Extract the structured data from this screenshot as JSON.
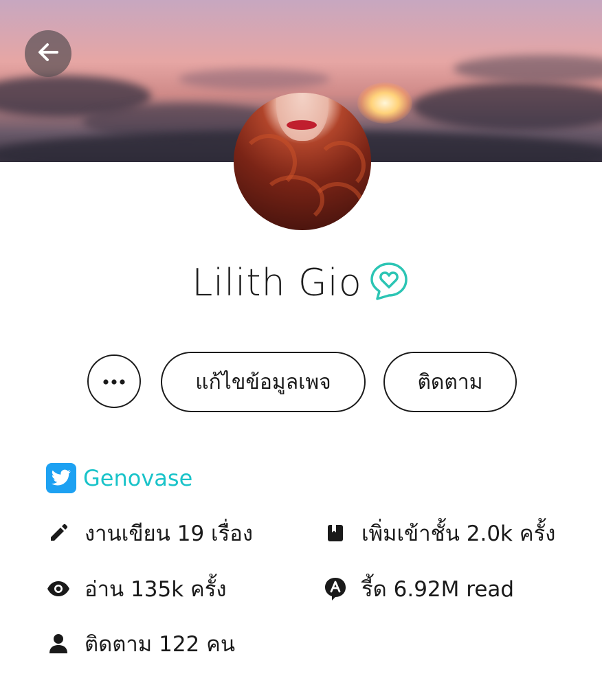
{
  "header": {
    "back_icon": "arrow-left-icon"
  },
  "profile": {
    "name": "Lilith Gio",
    "badge_icon": "heart-chat-badge-icon",
    "badge_color": "#2cc5b4"
  },
  "actions": {
    "more_icon": "ellipsis-icon",
    "edit_page_label": "แก้ไขข้อมูลเพจ",
    "follow_label": "ติดตาม"
  },
  "social": {
    "twitter_icon": "twitter-icon",
    "twitter_handle": "Genovase",
    "twitter_color": "#1da1f2",
    "link_color": "#19c3c9"
  },
  "stats": {
    "works": {
      "icon": "pencil-icon",
      "text": "งานเขียน 19 เรื่อง"
    },
    "shelf": {
      "icon": "bookmark-book-icon",
      "text": "เพิ่มเข้าชั้น 2.0k ครั้ง"
    },
    "views": {
      "icon": "eye-icon",
      "text": "อ่าน 135k ครั้ง"
    },
    "reads": {
      "icon": "read-badge-icon",
      "text": "รี้ด 6.92M read"
    },
    "followers": {
      "icon": "person-icon",
      "text": "ติดตาม 122 คน"
    }
  }
}
